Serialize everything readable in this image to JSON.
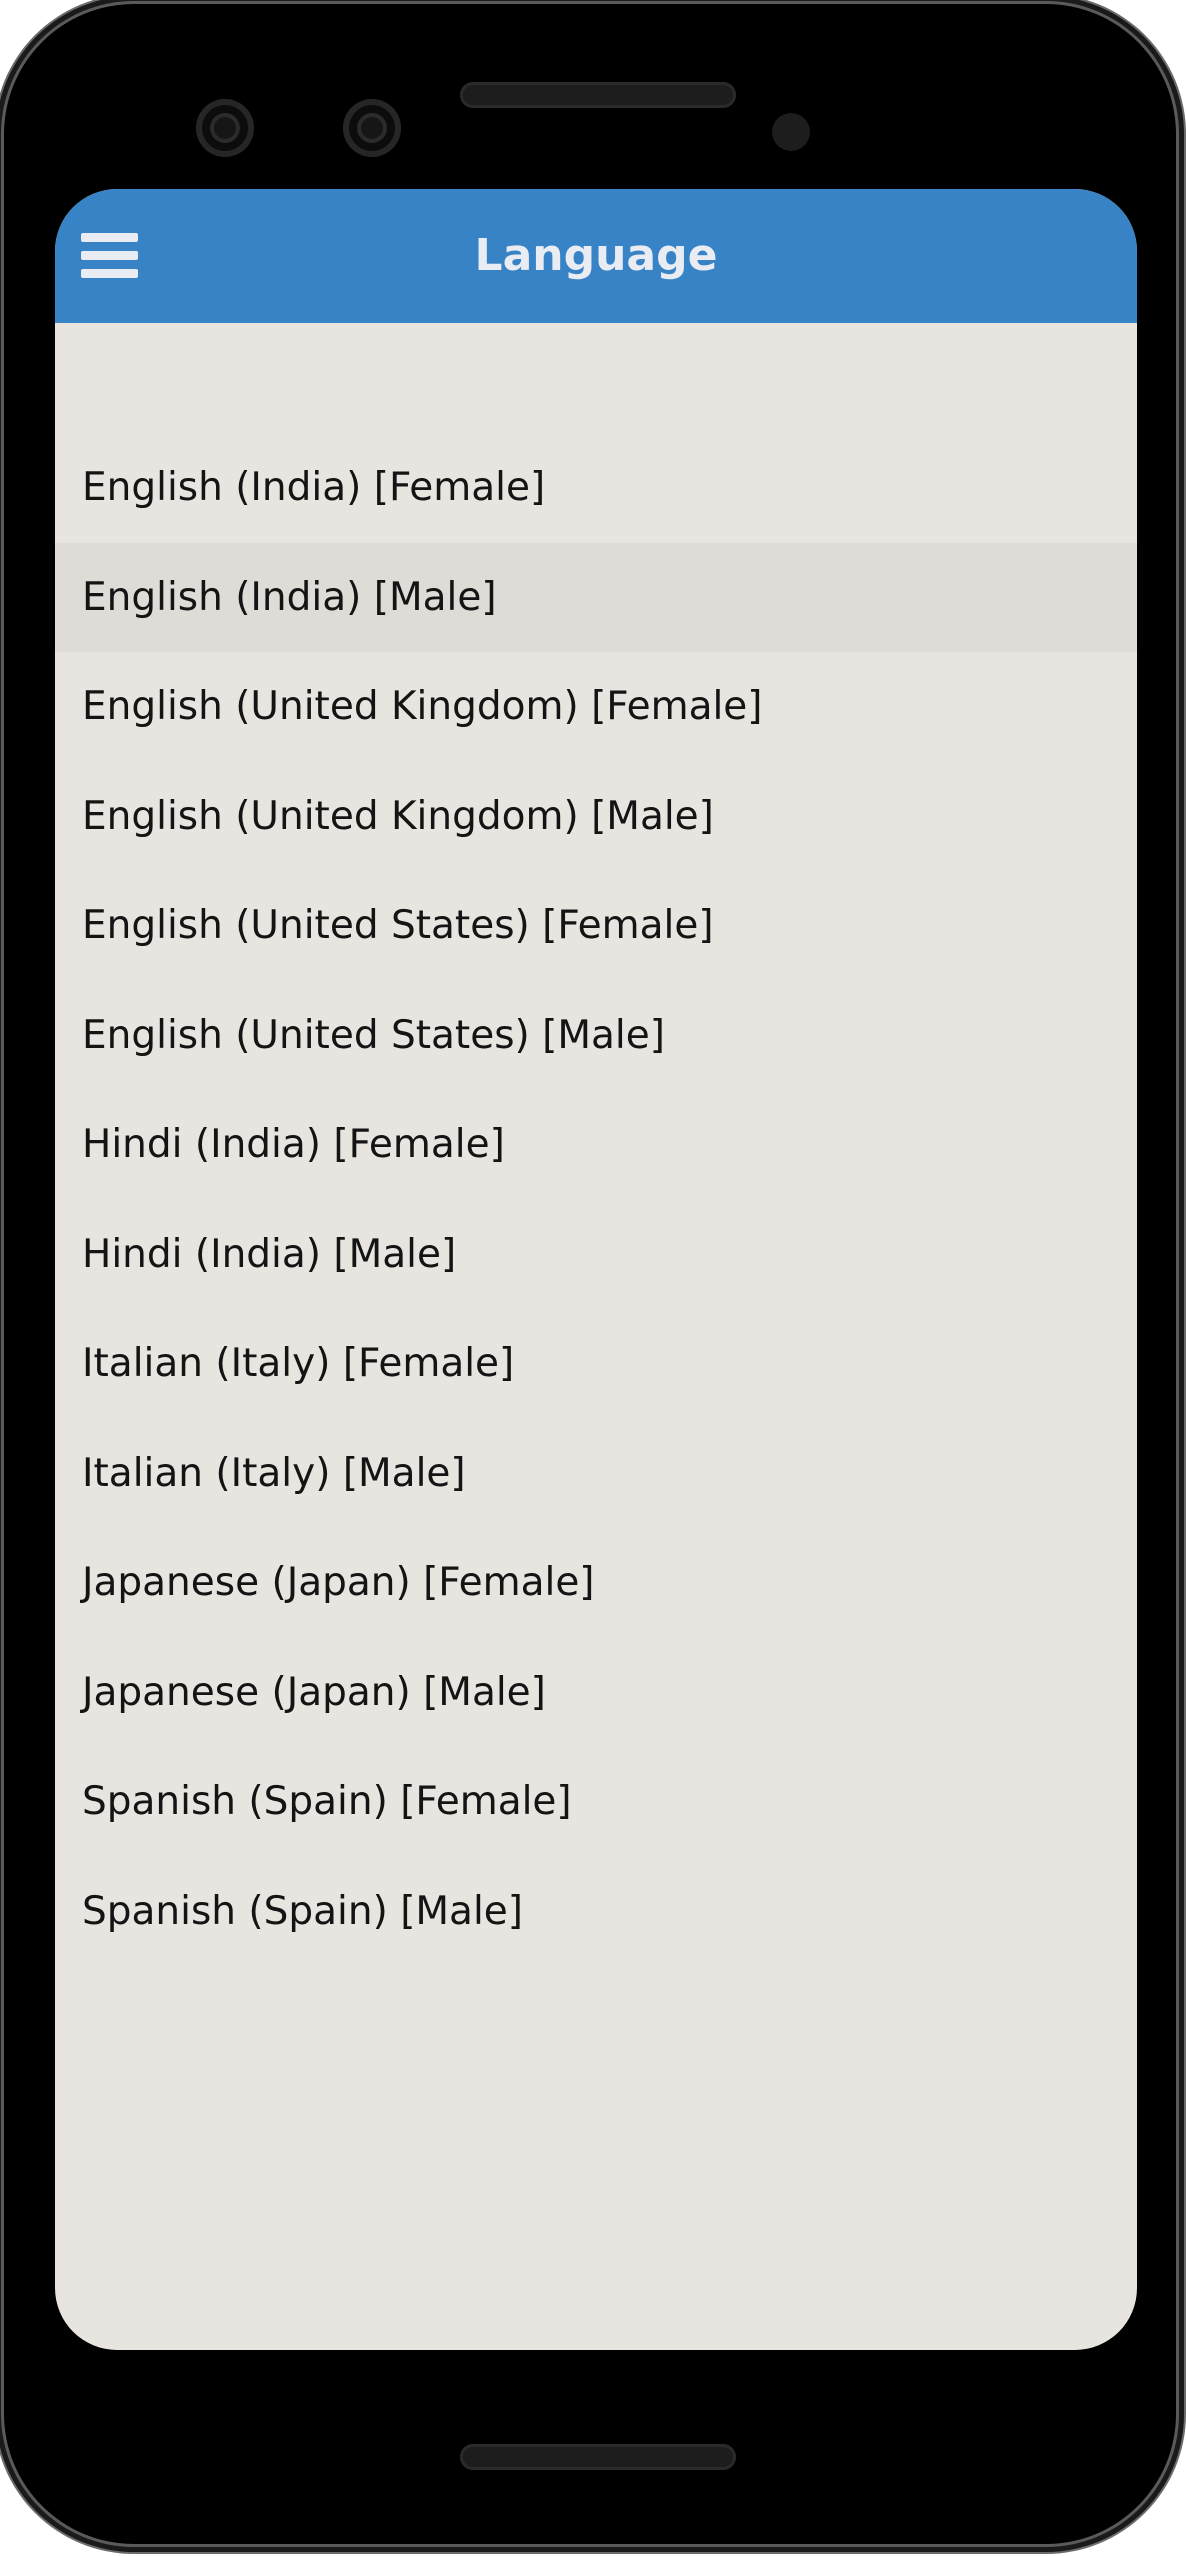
{
  "app_bar": {
    "title": "Language",
    "menu_icon": "hamburger-menu-icon",
    "background_color": "#3883c6"
  },
  "screen_background_color": "#e8e5e1",
  "languages": [
    {
      "label": "English (India) [Female]",
      "highlighted": false
    },
    {
      "label": "English (India) [Male]",
      "highlighted": true
    },
    {
      "label": "English (United Kingdom) [Female]",
      "highlighted": false
    },
    {
      "label": "English (United Kingdom) [Male]",
      "highlighted": false
    },
    {
      "label": "English (United States) [Female]",
      "highlighted": false
    },
    {
      "label": "English (United States) [Male]",
      "highlighted": false
    },
    {
      "label": "Hindi (India) [Female]",
      "highlighted": false
    },
    {
      "label": "Hindi (India) [Male]",
      "highlighted": false
    },
    {
      "label": "Italian (Italy) [Female]",
      "highlighted": false
    },
    {
      "label": "Italian (Italy) [Male]",
      "highlighted": false
    },
    {
      "label": "Japanese (Japan) [Female]",
      "highlighted": false
    },
    {
      "label": "Japanese (Japan) [Male]",
      "highlighted": false
    },
    {
      "label": "Spanish (Spain) [Female]",
      "highlighted": false
    },
    {
      "label": "Spanish (Spain) [Male]",
      "highlighted": false
    }
  ]
}
